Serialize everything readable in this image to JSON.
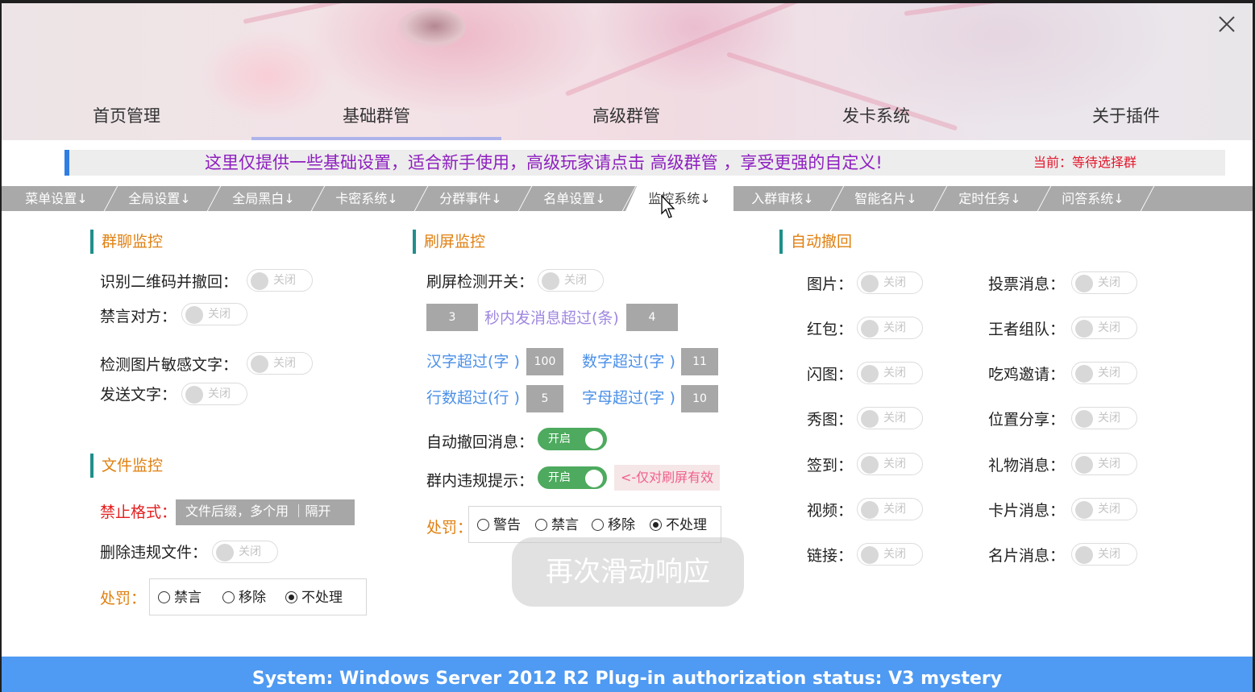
{
  "top_nav": [
    "首页管理",
    "基础群管",
    "高级群管",
    "发卡系统",
    "关于插件"
  ],
  "info": {
    "message": "这里仅提供一些基础设置，适合新手使用，高级玩家请点击 高级群管 ，享受更强的自定义!",
    "current": "当前：等待选择群"
  },
  "tabs": [
    "菜单设置↓",
    "全局设置↓",
    "全局黑白↓",
    "卡密系统↓",
    "分群事件↓",
    "名单设置↓",
    "监控系统↓",
    "入群审核↓",
    "智能名片↓",
    "定时任务↓",
    "问答系统↓"
  ],
  "toggle_text": {
    "off": "关闭",
    "on": "开启"
  },
  "group_monitor": {
    "title": "群聊监控",
    "qrcode_label": "识别二维码并撤回：",
    "mute_label": "禁言对方：",
    "image_text_label": "检测图片敏感文字：",
    "send_text_label": "发送文字："
  },
  "file_monitor": {
    "title": "文件监控",
    "forbid_label": "禁止格式：",
    "forbid_placeholder": "文件后缀，多个用 ｜隔开",
    "delete_label": "删除违规文件：",
    "punish_label": "处罚：",
    "punish_options": [
      "禁言",
      "移除",
      "不处理"
    ]
  },
  "spam_monitor": {
    "title": "刷屏监控",
    "switch_label": "刷屏检测开关：",
    "seconds_value": "3",
    "rate_label": "秒内发消息超过(条)",
    "rate_value": "4",
    "hanzi_label": "汉字超过(字 )",
    "hanzi_value": "100",
    "digit_label": "数字超过(字 )",
    "digit_value": "11",
    "lines_label": "行数超过(行 )",
    "lines_value": "5",
    "letters_label": "字母超过(字 )",
    "letters_value": "10",
    "auto_recall_label": "自动撤回消息：",
    "violation_label": "群内违规提示：",
    "violation_hint": "<-仅对刷屏有效",
    "punish_label": "处罚：",
    "punish_options": [
      "警告",
      "禁言",
      "移除",
      "不处理"
    ]
  },
  "auto_recall": {
    "title": "自动撤回",
    "left": [
      "图片：",
      "红包：",
      "闪图：",
      "秀图：",
      "签到：",
      "视频：",
      "链接："
    ],
    "right": [
      "投票消息：",
      "王者组队：",
      "吃鸡邀请：",
      "位置分享：",
      "礼物消息：",
      "卡片消息：",
      "名片消息："
    ]
  },
  "overlay": "再次滑动响应",
  "status": "System:  Windows Server 2012 R2  Plug-in authorization status:  V3 mystery",
  "colors": {
    "accent": "#4f9af2",
    "section_bar": "#1f8f8a",
    "section_title": "#e08010",
    "toggle_on": "#4daa5e",
    "info_text": "#8e1fbf"
  }
}
